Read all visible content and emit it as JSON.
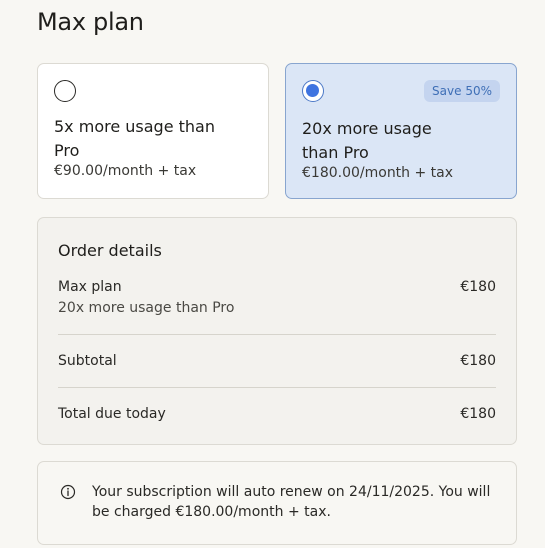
{
  "page": {
    "title": "Max plan"
  },
  "plans": [
    {
      "name": "5x more usage than Pro",
      "price": "€90.00/month + tax",
      "selected": false
    },
    {
      "name": "20x more usage than Pro",
      "price": "€180.00/month + tax",
      "selected": true,
      "badge": "Save 50%"
    }
  ],
  "order": {
    "title": "Order details",
    "item_name": "Max plan",
    "item_desc": "20x more usage than Pro",
    "item_price": "€180",
    "subtotal_label": "Subtotal",
    "subtotal_value": "€180",
    "total_label": "Total due today",
    "total_value": "€180"
  },
  "notice": {
    "icon": "info-icon",
    "text": "Your subscription will auto renew on 24/11/2025. You will be charged €180.00/month + tax."
  },
  "colors": {
    "background": "#f8f7f3",
    "selected_card": "#dbe6f6",
    "selected_border": "#88a5cf",
    "accent": "#3f74e0",
    "badge_bg": "#c4d4ef",
    "badge_text": "#3f6fb6"
  }
}
